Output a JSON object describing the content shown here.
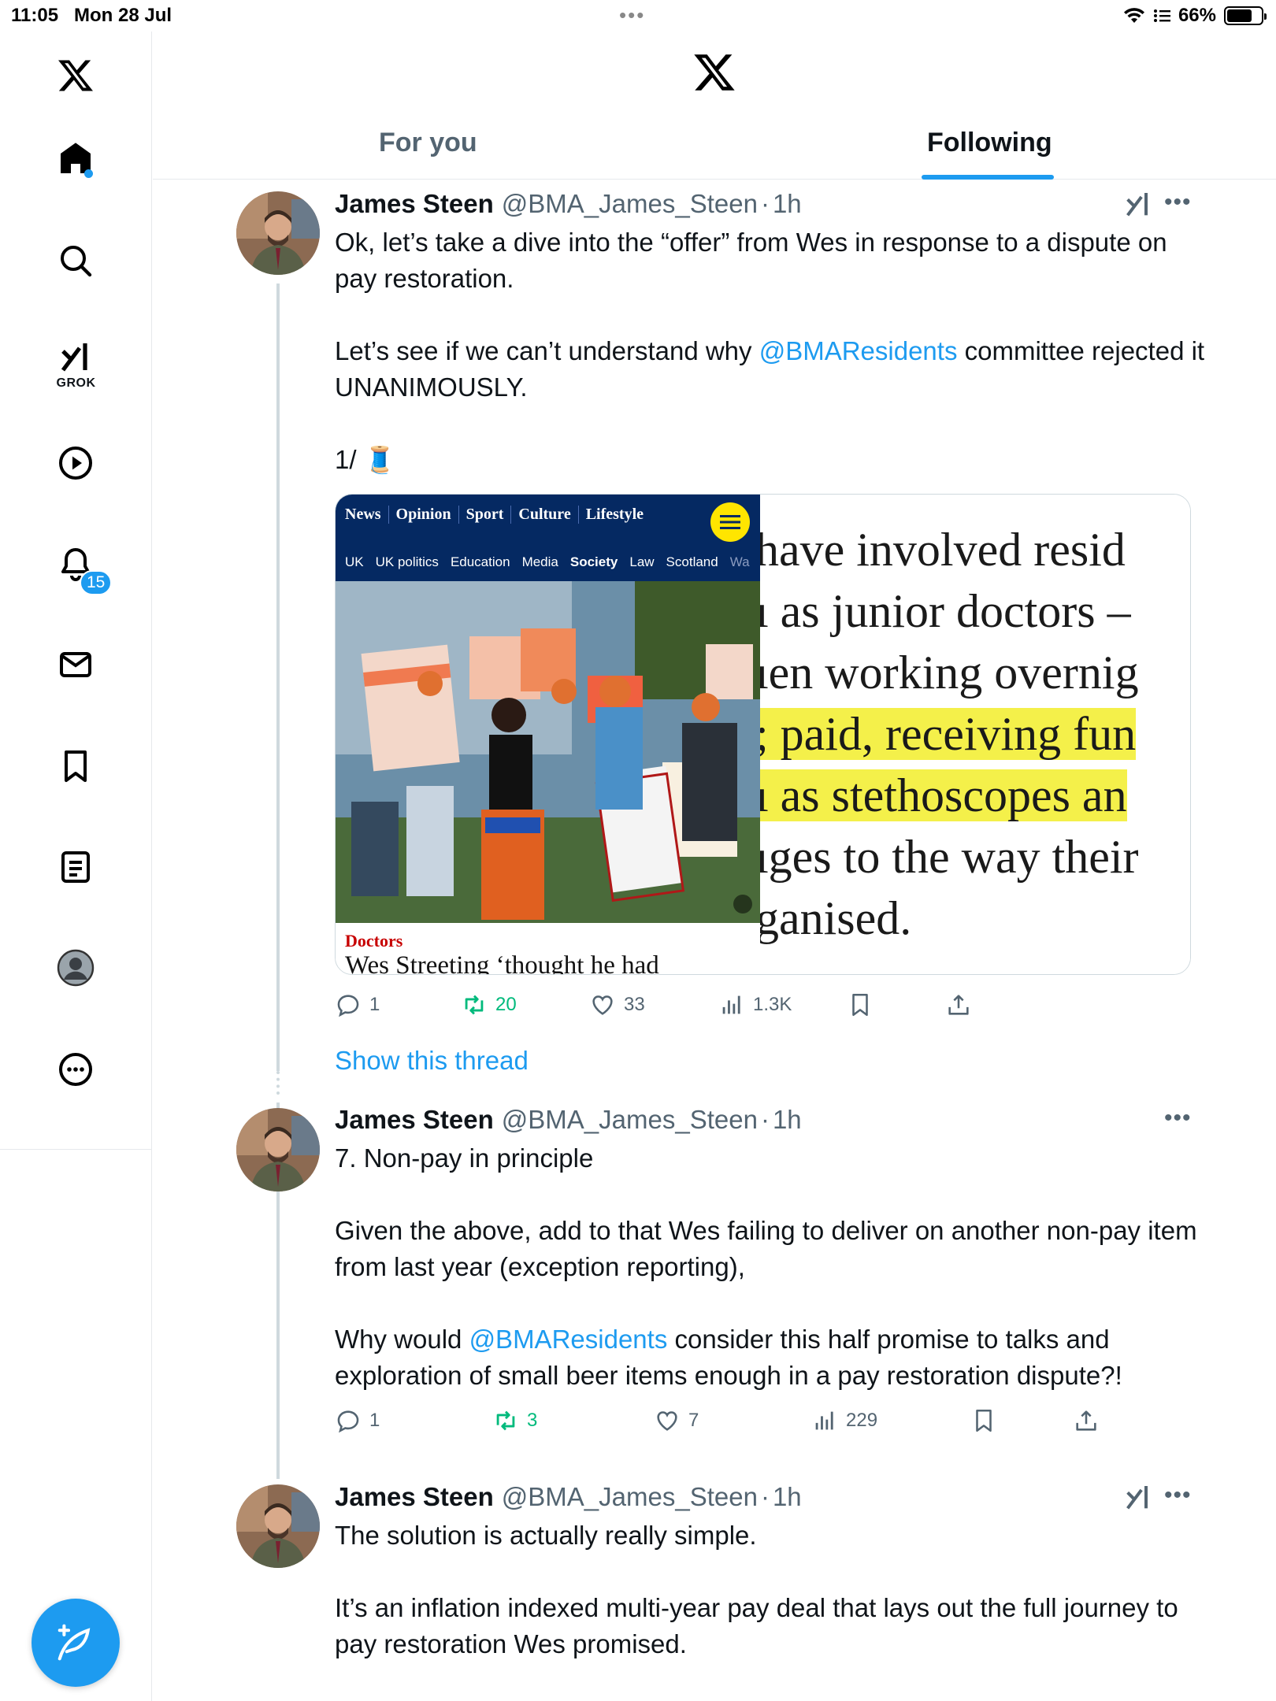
{
  "status_bar": {
    "time": "11:05",
    "date": "Mon 28 Jul",
    "battery": "66%"
  },
  "sidebar": {
    "grok_label": "GROK",
    "notification_count": "15"
  },
  "header": {
    "tabs": [
      {
        "label": "For you"
      },
      {
        "label": "Following"
      }
    ],
    "active_tab": "Following"
  },
  "tweets": [
    {
      "name": "James Steen",
      "handle": "@BMA_James_Steen",
      "time": "1h",
      "paragraphs": [
        "Ok, let’s take a dive into the “offer” from Wes in response to a dispute on pay restoration.",
        "committee rejected it UNANIMOUSLY.",
        "1/ 🧵"
      ],
      "p2_prefix": "Let’s see if we can’t understand why ",
      "mention": "@BMAResidents",
      "stats": {
        "replies": "1",
        "reposts": "20",
        "likes": "33",
        "views": "1.3K"
      },
      "media": {
        "nav": [
          "News",
          "Opinion",
          "Sport",
          "Culture",
          "Lifestyle"
        ],
        "subnav": [
          "UK",
          "UK politics",
          "Education",
          "Media",
          "Society",
          "Law",
          "Scotland",
          "Wa"
        ],
        "kicker": "Doctors",
        "headline": "Wes Streeting ‘thought he had",
        "quote_lines": [
          "have involved resid",
          "ı as junior doctors –",
          "ıen working overnig",
          "; paid, receiving fun",
          "ı as stethoscopes an",
          "ıges to the way their",
          "ganised."
        ]
      }
    },
    {
      "name": "James Steen",
      "handle": "@BMA_James_Steen",
      "time": "1h",
      "paragraphs": [
        "7. Non-pay in principle",
        "Given the above, add to that Wes failing to deliver on another non-pay item from last year (exception reporting),"
      ],
      "p3_prefix": "Why would ",
      "mention": "@BMAResidents",
      "p3_suffix": " consider this half promise to talks and exploration of small beer items enough in a pay restoration dispute?!",
      "stats": {
        "replies": "1",
        "reposts": "3",
        "likes": "7",
        "views": "229"
      }
    },
    {
      "name": "James Steen",
      "handle": "@BMA_James_Steen",
      "time": "1h",
      "paragraphs": [
        "The solution is actually really simple.",
        "It’s an inflation indexed multi-year pay deal that lays out the full journey to pay restoration Wes promised."
      ]
    }
  ],
  "show_thread_label": "Show this thread",
  "colors": {
    "accent": "#1d9bf0",
    "repost": "#00ba7c",
    "guardian_blue": "#052962",
    "highlight": "#f4f04a"
  }
}
